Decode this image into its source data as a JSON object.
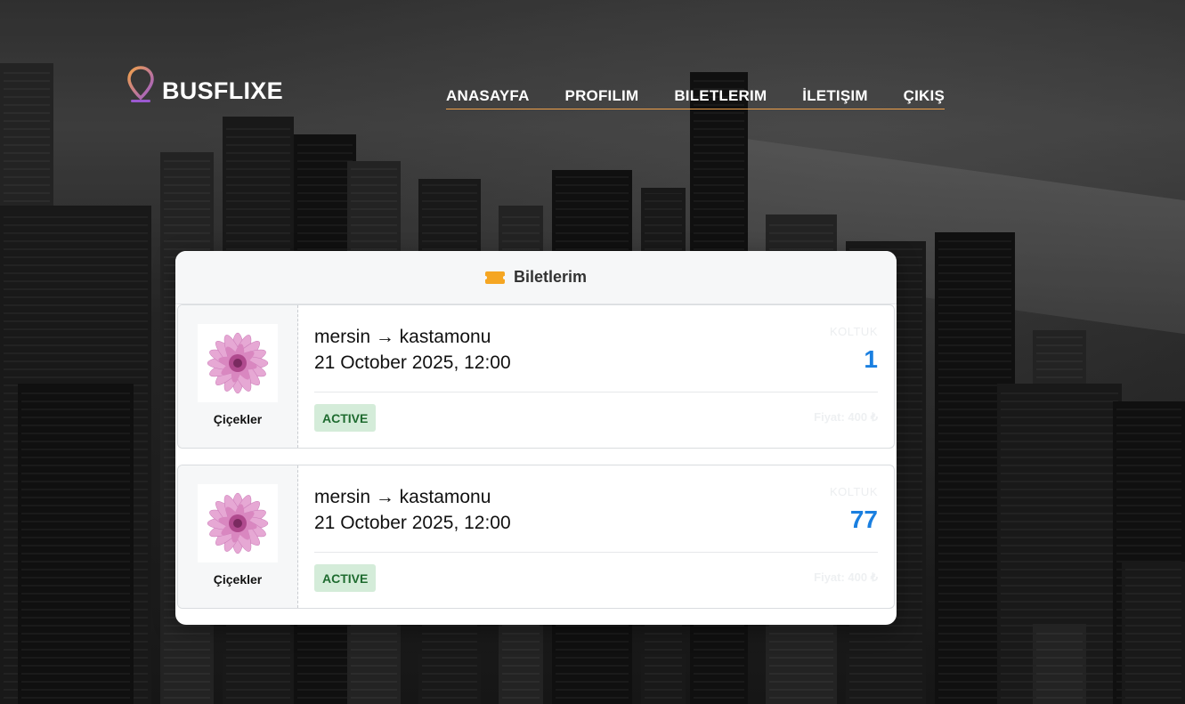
{
  "header": {
    "brand": "BUSFLIXE",
    "nav": [
      "ANASAYFA",
      "PROFILIM",
      "BILETLERIM",
      "İLETIŞIM",
      "ÇIKIŞ"
    ]
  },
  "panel": {
    "title": "Biletlerim",
    "icon": "ticket-icon"
  },
  "tickets": [
    {
      "company": "Çiçekler",
      "route": "mersin → kastamonu",
      "date": "21 October 2025, 12:00",
      "seat_label": "KOLTUK",
      "seat": "1",
      "status": "ACTIVE",
      "price": "Fiyat: 400 ₺"
    },
    {
      "company": "Çiçekler",
      "route": "mersin → kastamonu",
      "date": "21 October 2025, 12:00",
      "seat_label": "KOLTUK",
      "seat": "77",
      "status": "ACTIVE",
      "price": "Fiyat: 400 ₺"
    }
  ],
  "colors": {
    "accent": "#f0a14a",
    "seat": "#1a7fe0",
    "status_bg": "#d4ecd9",
    "status_text": "#1e6b2f"
  }
}
